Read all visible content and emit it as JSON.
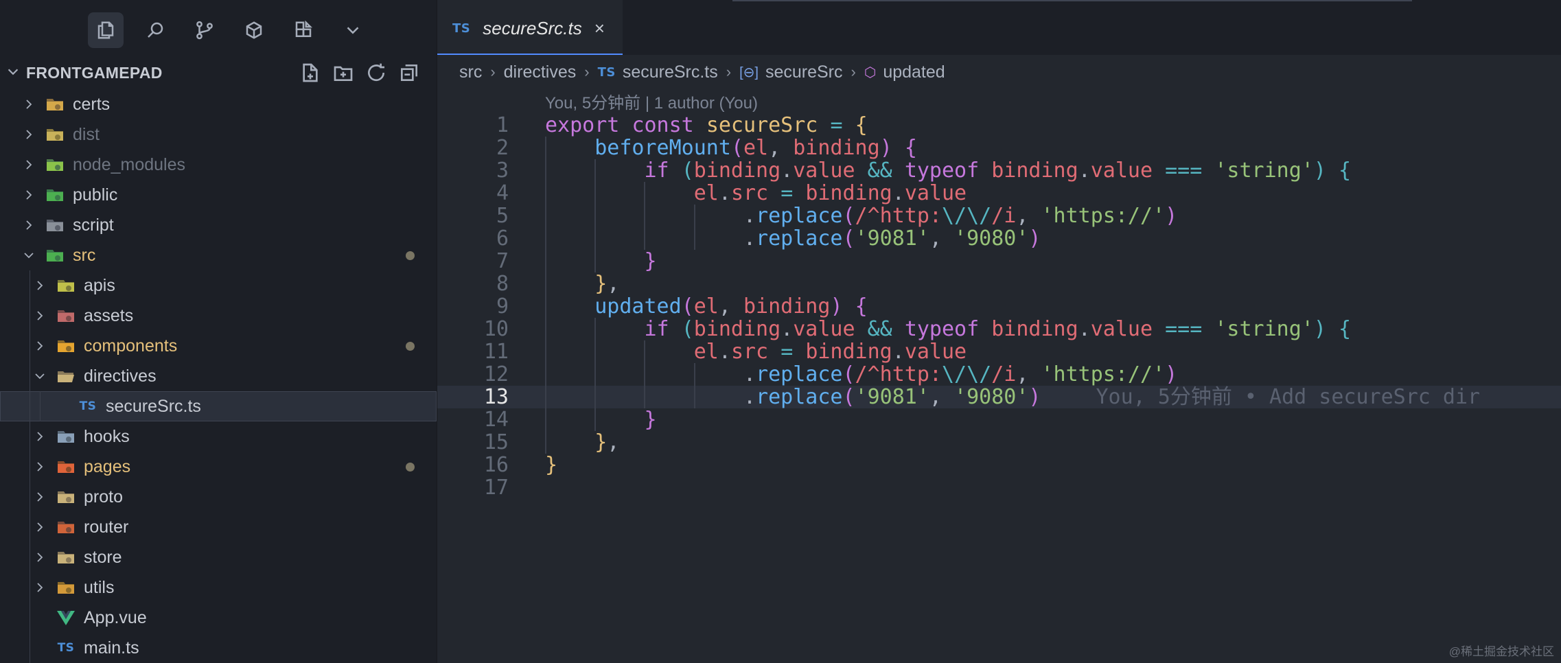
{
  "sidebar": {
    "title": "FRONTGAMEPAD",
    "tree": [
      {
        "name": "certs",
        "type": "folder",
        "expanded": false,
        "depth": 0,
        "style": "normal"
      },
      {
        "name": "dist",
        "type": "folder",
        "expanded": false,
        "depth": 0,
        "style": "dim"
      },
      {
        "name": "node_modules",
        "type": "folder",
        "expanded": false,
        "depth": 0,
        "style": "dim"
      },
      {
        "name": "public",
        "type": "folder",
        "expanded": false,
        "depth": 0,
        "style": "normal"
      },
      {
        "name": "script",
        "type": "folder",
        "expanded": false,
        "depth": 0,
        "style": "normal"
      },
      {
        "name": "src",
        "type": "folder",
        "expanded": true,
        "depth": 0,
        "style": "mod",
        "modified": true
      },
      {
        "name": "apis",
        "type": "folder",
        "expanded": false,
        "depth": 1,
        "style": "normal"
      },
      {
        "name": "assets",
        "type": "folder",
        "expanded": false,
        "depth": 1,
        "style": "normal"
      },
      {
        "name": "components",
        "type": "folder",
        "expanded": false,
        "depth": 1,
        "style": "mod",
        "modified": true
      },
      {
        "name": "directives",
        "type": "folder",
        "expanded": true,
        "depth": 1,
        "style": "normal"
      },
      {
        "name": "secureSrc.ts",
        "type": "ts",
        "depth": 2,
        "style": "normal",
        "selected": true
      },
      {
        "name": "hooks",
        "type": "folder",
        "expanded": false,
        "depth": 1,
        "style": "normal"
      },
      {
        "name": "pages",
        "type": "folder",
        "expanded": false,
        "depth": 1,
        "style": "mod",
        "modified": true
      },
      {
        "name": "proto",
        "type": "folder",
        "expanded": false,
        "depth": 1,
        "style": "normal"
      },
      {
        "name": "router",
        "type": "folder",
        "expanded": false,
        "depth": 1,
        "style": "normal"
      },
      {
        "name": "store",
        "type": "folder",
        "expanded": false,
        "depth": 1,
        "style": "normal"
      },
      {
        "name": "utils",
        "type": "folder",
        "expanded": false,
        "depth": 1,
        "style": "normal"
      },
      {
        "name": "App.vue",
        "type": "vue",
        "depth": 1,
        "style": "normal"
      },
      {
        "name": "main.ts",
        "type": "ts",
        "depth": 1,
        "style": "normal"
      }
    ]
  },
  "tab": {
    "badge": "TS",
    "title": "secureSrc.ts",
    "close": "×"
  },
  "breadcrumb": {
    "parts": [
      "src",
      "directives"
    ],
    "file_badge": "TS",
    "file": "secureSrc.ts",
    "symbol1": "secureSrc",
    "symbol2": "updated"
  },
  "blame_header": "You, 5分钟前 | 1 author (You)",
  "inline_blame": "You, 5分钟前 • Add secureSrc dir",
  "current_line": 13,
  "line_numbers": [
    "1",
    "2",
    "3",
    "4",
    "5",
    "6",
    "7",
    "8",
    "9",
    "10",
    "11",
    "12",
    "13",
    "14",
    "15",
    "16",
    "17"
  ],
  "code_lines": [
    "export const secureSrc = {",
    "    beforeMount(el, binding) {",
    "        if (binding.value && typeof binding.value === 'string') {",
    "            el.src = binding.value",
    "                .replace(/^http:\\/\\//i, 'https://')",
    "                .replace('9081', '9080')",
    "        }",
    "    },",
    "    updated(el, binding) {",
    "        if (binding.value && typeof binding.value === 'string') {",
    "            el.src = binding.value",
    "                .replace(/^http:\\/\\//i, 'https://')",
    "                .replace('9081', '9080')",
    "        }",
    "    },",
    "}",
    ""
  ],
  "watermark": "@稀土掘金技术社区"
}
